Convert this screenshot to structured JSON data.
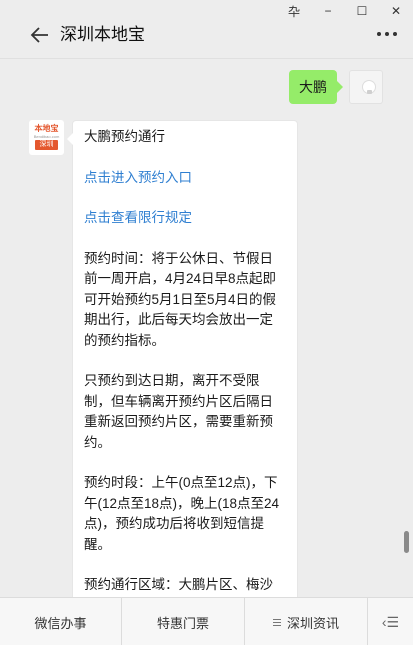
{
  "window": {
    "controls": [
      "卆",
      "−",
      "☐",
      "✕"
    ]
  },
  "header": {
    "title": "深圳本地宝"
  },
  "chat": {
    "outgoing": {
      "text": "大鹏"
    },
    "account": {
      "logo_main": "本地宝",
      "logo_sub": "Bendibao.com",
      "logo_tag": "深圳"
    },
    "incoming": {
      "paragraphs": [
        {
          "text": "大鹏预约通行",
          "link": false
        },
        {
          "text": "点击进入预约入口",
          "link": true
        },
        {
          "text": "点击查看限行规定",
          "link": true
        },
        {
          "text": "预约时间：将于公休日、节假日前一周开启，4月24日早8点起即可开始预约5月1日至5月4日的假期出行，此后每天均会放出一定的预约指标。",
          "link": false
        },
        {
          "text": "只预约到达日期，离开不受限制，但车辆离开预约片区后隔日重新返回预约片区，需要重新预约。",
          "link": false
        },
        {
          "text": "预约时段：上午(0点至12点)，下午(12点至18点)，晚上(18点至24点)，预约成功后将收到短信提醒。",
          "link": false
        },
        {
          "text": "预约通行区域：大鹏片区、梅沙片区（具体可查限行规定里的内容）",
          "link": false
        }
      ]
    }
  },
  "bottom_menu": {
    "items": [
      "微信办事",
      "特惠门票",
      "深圳资讯"
    ],
    "keyboard_glyph": "‹☰"
  }
}
